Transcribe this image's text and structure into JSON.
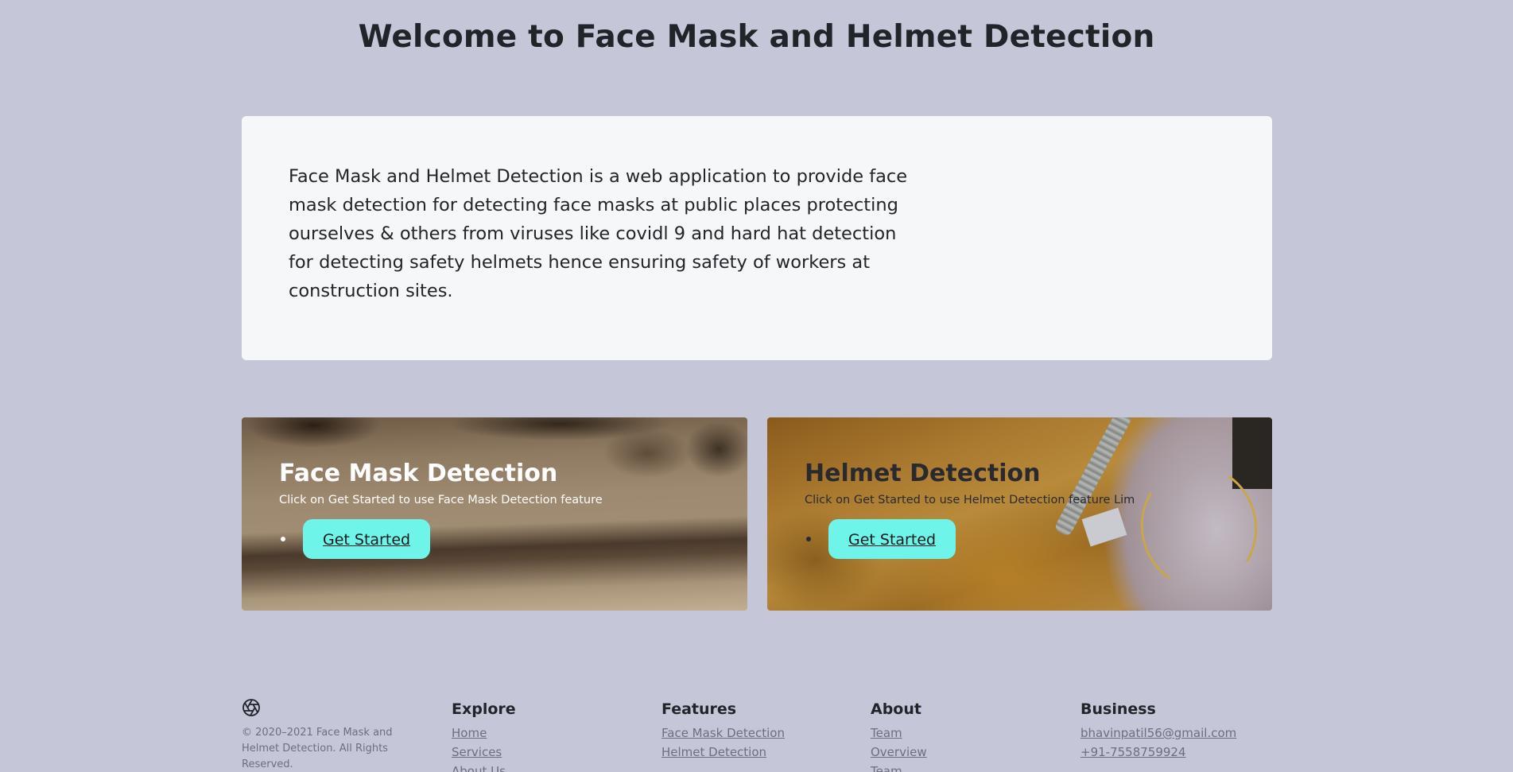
{
  "header": {
    "title": "Welcome to Face Mask and Helmet Detection"
  },
  "intro": {
    "text": "Face Mask and Helmet Detection is a web application to provide face mask detection for detecting face masks at public places protecting ourselves & others from viruses like covidl 9 and hard hat detection for detecting safety helmets hence ensuring safety of workers at construction sites."
  },
  "cards": [
    {
      "title": "Face Mask Detection",
      "subtitle": "Click on Get Started to use Face Mask Detection feature",
      "button_label": "Get Started"
    },
    {
      "title": "Helmet Detection",
      "subtitle": "Click on Get Started to use Helmet Detection feature Lim",
      "button_label": "Get Started"
    }
  ],
  "footer": {
    "logo_icon": "aperture-icon",
    "copyright": "© 2020–2021 Face Mask and Helmet Detection. All Rights Reserved.",
    "explore": {
      "heading": "Explore",
      "links": [
        "Home",
        "Services",
        "About Us"
      ]
    },
    "features": {
      "heading": "Features",
      "links": [
        "Face Mask Detection",
        "Helmet Detection"
      ]
    },
    "about": {
      "heading": "About",
      "links": [
        "Team",
        "Overview",
        "Team"
      ]
    },
    "business": {
      "heading": "Business",
      "links": [
        "bhavinpatil56@gmail.com",
        "+91-7558759924"
      ]
    }
  },
  "colors": {
    "page_background": "#c5c7d9",
    "card_background": "#f6f7f9",
    "button_accent": "#6ff4ea",
    "heading_text": "#212529",
    "muted_text": "#6c6f7d"
  }
}
